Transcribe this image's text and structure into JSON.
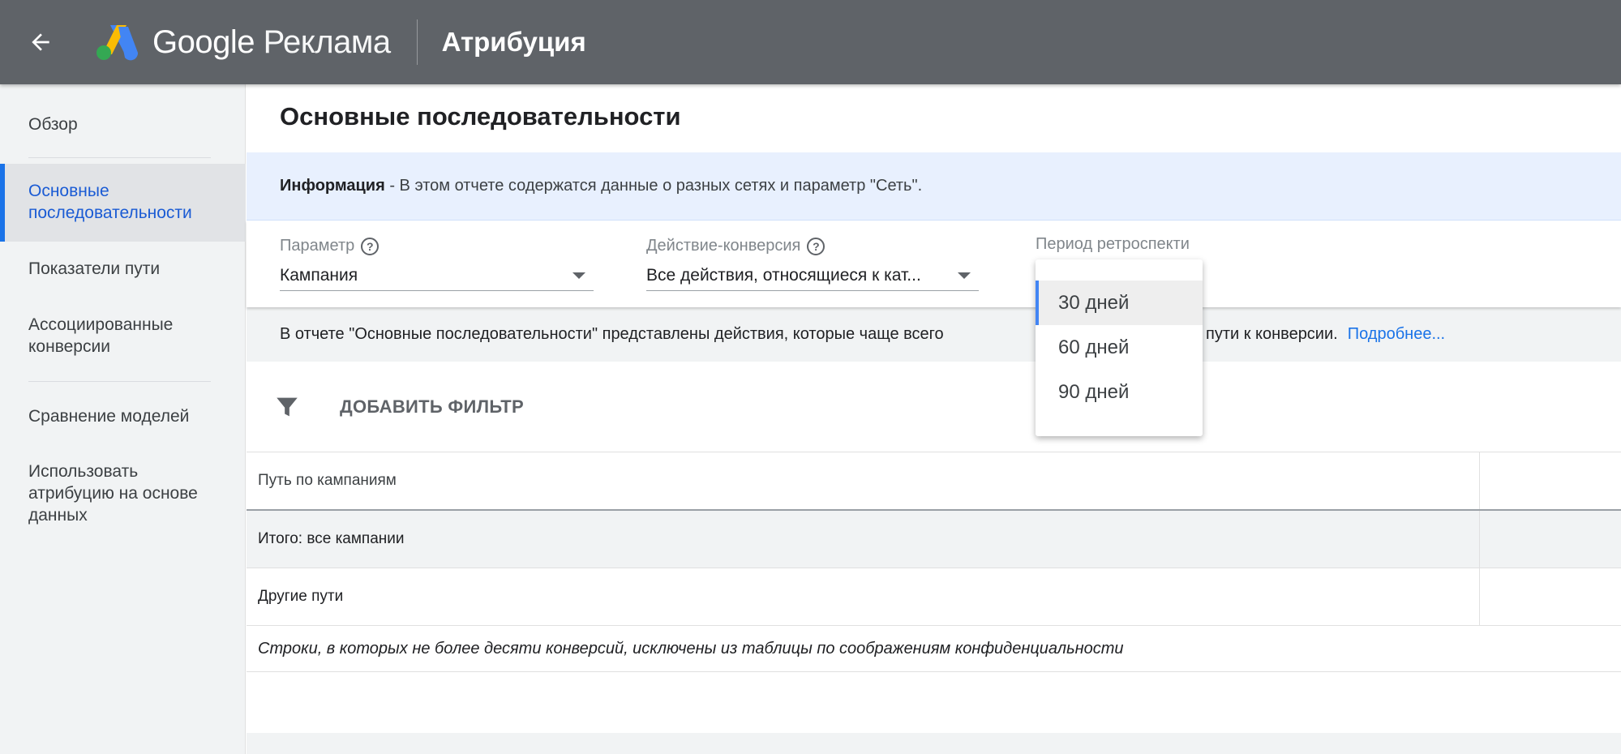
{
  "header": {
    "brand_google": "Google",
    "brand_product": "Реклама",
    "section": "Атрибуция"
  },
  "sidebar": {
    "items": [
      {
        "label": "Обзор"
      },
      {
        "label": "Основные последовательности"
      },
      {
        "label": "Показатели пути"
      },
      {
        "label": "Ассоциированные конверсии"
      },
      {
        "label": "Сравнение моделей"
      },
      {
        "label": "Использовать атрибуцию на основе данных"
      }
    ]
  },
  "main": {
    "title": "Основные последовательности",
    "info_bold": "Информация",
    "info_text": " - В этом отчете содержатся данные о разных сетях и параметр \"Сеть\".",
    "filters": {
      "param_label": "Параметр",
      "param_value": "Кампания",
      "conversion_label": "Действие-конверсия",
      "conversion_value": "Все действия, относящиеся к кат...",
      "lookback_label": "Период ретроспекти"
    },
    "description_text": "В отчете \"Основные последовательности\" представлены действия, которые чаще всего",
    "description_tail": "затели на пути к конверсии.",
    "description_link": "Подробнее...",
    "add_filter": "ДОБАВИТЬ ФИЛЬТР",
    "table": {
      "header": "Путь по кампаниям",
      "rows": [
        "Итого: все кампании",
        "Другие пути"
      ],
      "note": "Строки, в которых не более десяти конверсий, исключены из таблицы по соображениям конфиденциальности"
    }
  },
  "lookback_menu": {
    "options": [
      "30 дней",
      "60 дней",
      "90 дней"
    ],
    "selected": "30 дней"
  },
  "colors": {
    "topbar": "#5f6368",
    "accent": "#1a73e8",
    "info_bg": "#e8f0fe"
  }
}
